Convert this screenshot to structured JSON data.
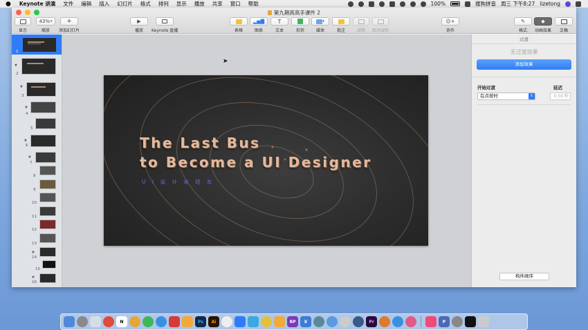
{
  "menubar": {
    "app_name": "Keynote 讲演",
    "items": [
      "文件",
      "编辑",
      "插入",
      "幻灯片",
      "格式",
      "排列",
      "显示",
      "播放",
      "共享",
      "窗口",
      "帮助"
    ],
    "battery": "100%",
    "input_method": "搜狗拼音",
    "clock": "周三 下午8:27",
    "user": "lizetong"
  },
  "window": {
    "title": "第九期高高手课件 2"
  },
  "toolbar": {
    "view_label": "显示",
    "zoom_value": "43%",
    "zoom_label": "缩放",
    "add_slide_label": "添加幻灯片",
    "play_label": "播放",
    "keynote_live_label": "Keynote 直播",
    "table_label": "表格",
    "chart_label": "图表",
    "text_label": "文本",
    "shape_label": "形状",
    "media_label": "媒体",
    "comment_label": "批注",
    "remove_label": "减粗",
    "cancel_remove_label": "取消减粗",
    "collaborate_label": "协作",
    "format_label": "格式",
    "animate_label": "动画效果",
    "document_label": "文稿"
  },
  "navigator": {
    "slides": [
      "1",
      "2",
      "3",
      "4",
      "5",
      "6",
      "7",
      "8",
      "9",
      "10",
      "11",
      "12",
      "13",
      "14",
      "15",
      "16"
    ]
  },
  "slide": {
    "title_line1": "The Last Bus",
    "title_line2": "to Become a UI Designer",
    "subtitle": "U I 设 计 末 班 车"
  },
  "inspector": {
    "header": "过渡",
    "no_transition": "无过渡效果",
    "add_effect": "添加效果",
    "start_label": "开始过渡",
    "delay_label": "延迟",
    "start_value": "在点按时",
    "delay_value": "0.50 秒",
    "build_order": "构件顺序"
  },
  "colors": {
    "accent": "#2f7cf6",
    "title_gold": "#e3b99c",
    "subtitle_purple": "#7f5fe0"
  }
}
